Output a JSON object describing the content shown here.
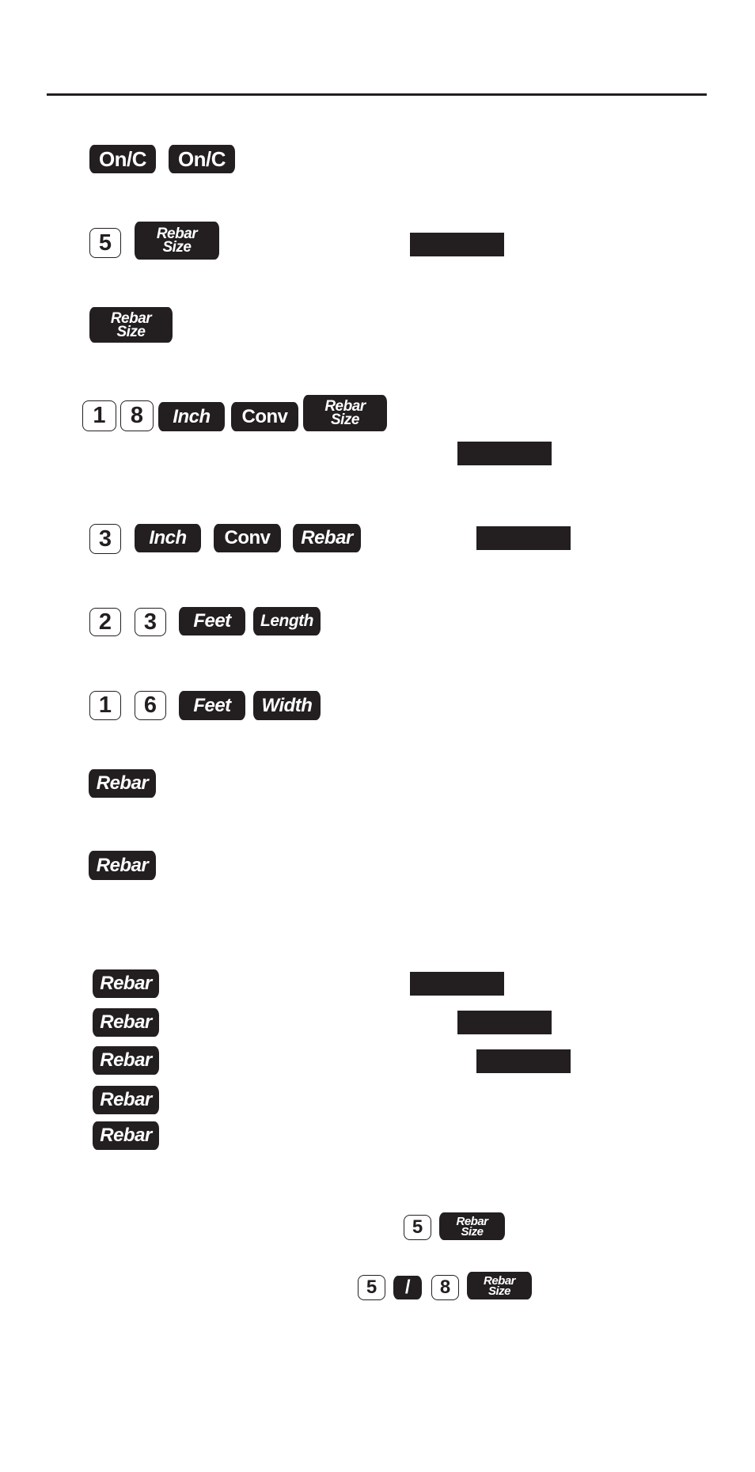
{
  "document": {
    "rows": [
      {
        "id": "row1",
        "keys": [
          "On/C",
          "On/C"
        ]
      },
      {
        "id": "row2",
        "keys": [
          "5",
          "Rebar Size"
        ]
      },
      {
        "id": "row3",
        "keys": [
          "Rebar Size"
        ]
      },
      {
        "id": "row4",
        "keys": [
          "1",
          "8",
          "Inch",
          "Conv",
          "Rebar Size"
        ]
      },
      {
        "id": "row5",
        "keys": [
          "3",
          "Inch",
          "Conv",
          "Rebar"
        ]
      },
      {
        "id": "row6",
        "keys": [
          "2",
          "3",
          "Feet",
          "Length"
        ]
      },
      {
        "id": "row7",
        "keys": [
          "1",
          "6",
          "Feet",
          "Width"
        ]
      },
      {
        "id": "row8",
        "keys": [
          "Rebar"
        ]
      },
      {
        "id": "row9",
        "keys": [
          "Rebar"
        ]
      },
      {
        "id": "row10",
        "keys": [
          "Rebar"
        ]
      },
      {
        "id": "row11",
        "keys": [
          "Rebar"
        ]
      },
      {
        "id": "row12",
        "keys": [
          "Rebar"
        ]
      },
      {
        "id": "row13",
        "keys": [
          "Rebar"
        ]
      },
      {
        "id": "row14",
        "keys": [
          "Rebar"
        ]
      },
      {
        "id": "note1",
        "keys": [
          "5",
          "Rebar Size"
        ]
      },
      {
        "id": "note2",
        "keys": [
          "5",
          "/",
          "8",
          "Rebar Size"
        ]
      }
    ],
    "labels": {
      "on_c": "On/C",
      "rebar": "Rebar",
      "size": "Size",
      "inch": "Inch",
      "conv": "Conv",
      "feet": "Feet",
      "length": "Length",
      "width": "Width",
      "slash": "/",
      "d1": "1",
      "d2": "2",
      "d3": "3",
      "d5": "5",
      "d6": "6",
      "d8": "8"
    },
    "redacted_display_count": 6
  }
}
